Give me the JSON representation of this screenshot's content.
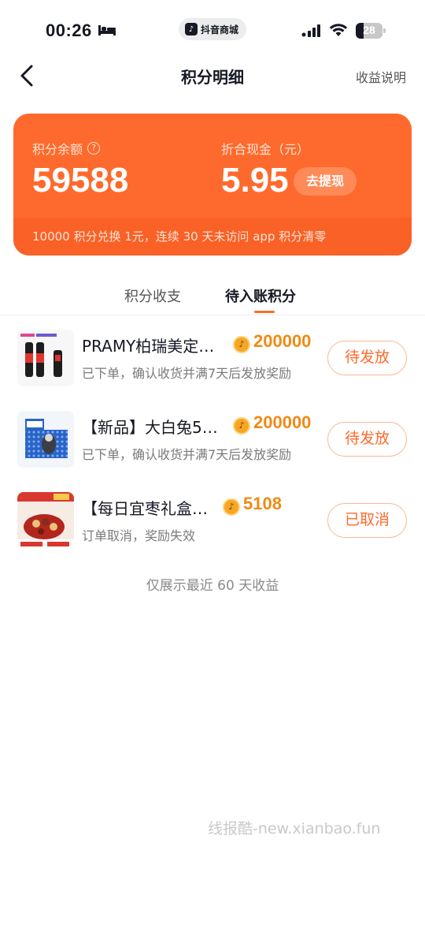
{
  "status_bar": {
    "time": "00:26",
    "app_name": "抖音商城",
    "battery": "28"
  },
  "nav": {
    "title": "积分明细",
    "right_link": "收益说明"
  },
  "card": {
    "balance_label": "积分余额",
    "balance_value": "59588",
    "cash_label": "折合现金（元）",
    "cash_value": "5.95",
    "withdraw_label": "去提现",
    "footer_text": "10000 积分兑换 1元，连续 30 天未访问 app 积分清零"
  },
  "tabs": [
    {
      "label": "积分收支",
      "active": false
    },
    {
      "label": "待入账积分",
      "active": true
    }
  ],
  "items": [
    {
      "title": "PRAMY柏瑞美定…",
      "points": "200000",
      "subtitle": "已下单，确认收货并满7天后发放奖励",
      "status": "待发放"
    },
    {
      "title": "【新品】大白兔5…",
      "points": "200000",
      "subtitle": "已下单，确认收货并满7天后发放奖励",
      "status": "待发放"
    },
    {
      "title": "【每日宜枣礼盒…",
      "points": "5108",
      "subtitle": "订单取消，奖励失效",
      "status": "已取消"
    }
  ],
  "footer_note": "仅展示最近 60 天收益",
  "watermark": "线报酷-new.xianbao.fun",
  "colors": {
    "accent": "#fe6a2d",
    "points": "#f08a14"
  }
}
